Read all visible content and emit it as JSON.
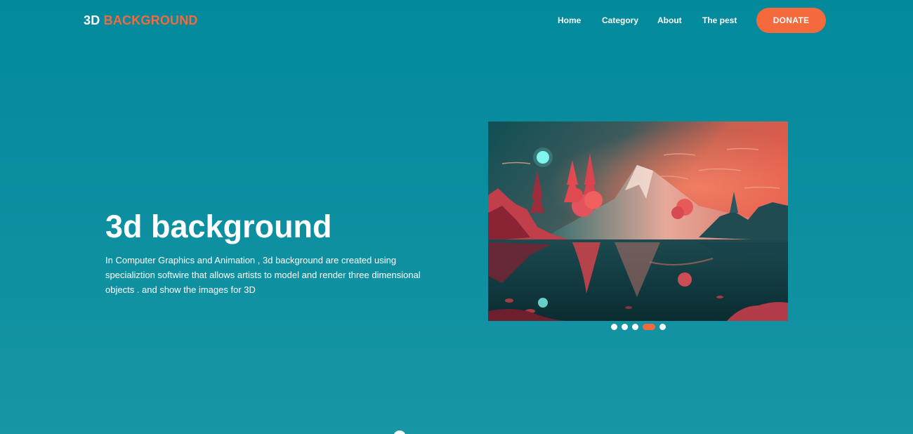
{
  "header": {
    "logo_prefix": "3D",
    "logo_accent": "BACKGROUND",
    "nav": [
      "Home",
      "Category",
      "About",
      "The pest"
    ],
    "donate_label": "DONATE"
  },
  "hero": {
    "title": "3d background",
    "description": "In Computer Graphics and Animation , 3d background are created using specializtion softwire that allows artists to model and render three dimensional objects . and show the images for 3D"
  },
  "carousel": {
    "slide_count": 5,
    "active_index": 3,
    "image_icon": "landscape-image"
  },
  "colors": {
    "background": "#0b8e9f",
    "accent": "#f46a3c",
    "text": "#ffffff"
  }
}
